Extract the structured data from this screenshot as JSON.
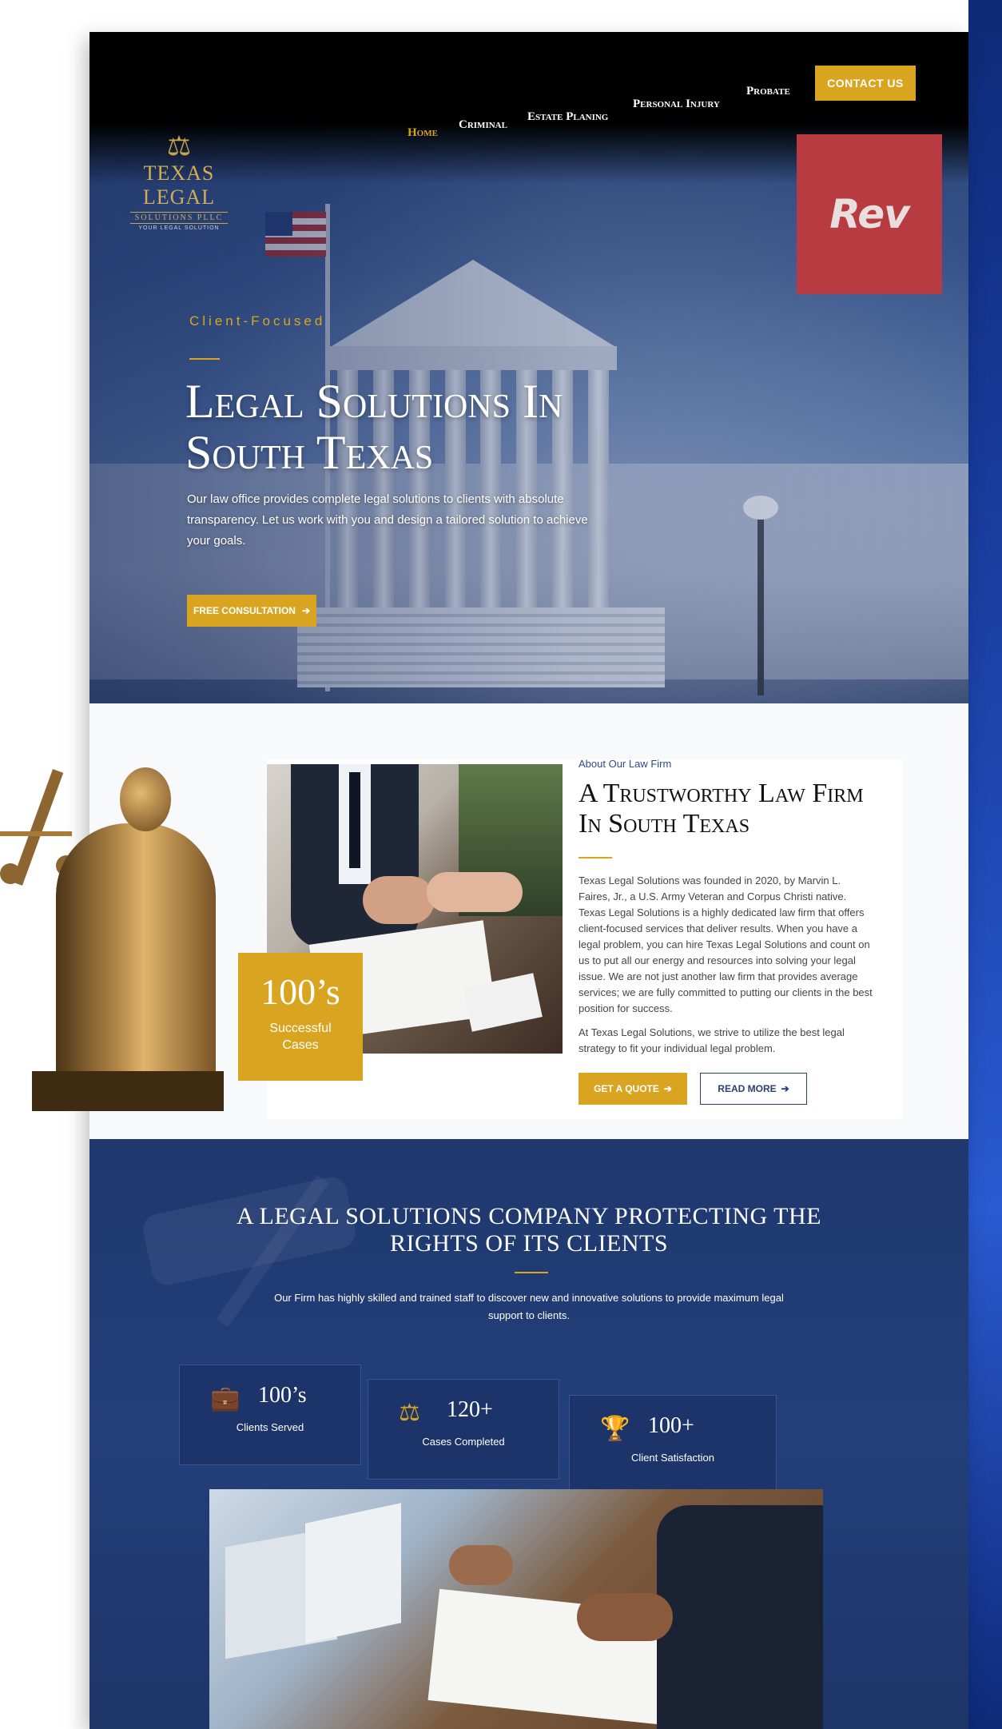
{
  "header": {
    "logo": {
      "mark": "⚖",
      "name": "TEXAS LEGAL",
      "sub": "SOLUTIONS PLLC",
      "tag": "YOUR LEGAL SOLUTION"
    },
    "nav": [
      {
        "label": "Home",
        "active": true
      },
      {
        "label": "Criminal",
        "active": false
      },
      {
        "label": "Estate Planing",
        "active": false
      },
      {
        "label": "Personal Injury",
        "active": false
      },
      {
        "label": "Probate",
        "active": false
      }
    ],
    "contact_label": "CONTACT US",
    "badge_text": "Rev"
  },
  "hero": {
    "eyebrow": "Client-Focused",
    "title": "Legal Solutions In South Texas",
    "body": "Our law office provides complete legal solutions to clients with absolute transparency. Let us work with you and design a tailored solution to achieve your goals.",
    "cta_label": "FREE CONSULTATION",
    "cta_icon": "arrow-right-icon"
  },
  "about": {
    "eyebrow": "About Our Law Firm",
    "title": "A Trustworthy Law Firm In South Texas",
    "paragraphs": [
      "Texas Legal Solutions was founded in 2020, by Marvin L. Faires, Jr., a U.S. Army Veteran and Corpus Christi native. Texas Legal Solutions is a highly dedicated law firm that offers client-focused services that deliver results. When you have a legal problem, you can hire Texas Legal Solutions and count on us to put all our energy and resources into solving your legal issue. We are not just another law firm that provides average services; we are fully committed to putting our clients in the best position for success.",
      "At Texas Legal Solutions, we strive to utilize the best legal strategy to fit your individual legal problem."
    ],
    "stat_number": "100’s",
    "stat_label_line1": "Successful",
    "stat_label_line2": "Cases",
    "quote_label": "GET A QUOTE",
    "readmore_label": "READ MORE"
  },
  "company": {
    "title_line1": "A LEGAL SOLUTIONS COMPANY PROTECTING THE",
    "title_line2": "RIGHTS OF ITS CLIENTS",
    "body": "Our Firm has highly skilled and trained staff to discover new and innovative solutions to provide maximum legal support to clients.",
    "stats": [
      {
        "icon": "briefcase-icon",
        "glyph": "💼",
        "number": "100’s",
        "label": "Clients Served"
      },
      {
        "icon": "scales-icon",
        "glyph": "⚖",
        "number": "120+",
        "label": "Cases Completed"
      },
      {
        "icon": "trophy-icon",
        "glyph": "🏆",
        "number": "100+",
        "label": "Client Satisfaction"
      }
    ]
  },
  "colors": {
    "gold": "#d9a521",
    "navy": "#1f386e",
    "edge_blue": "#1d46b0"
  }
}
